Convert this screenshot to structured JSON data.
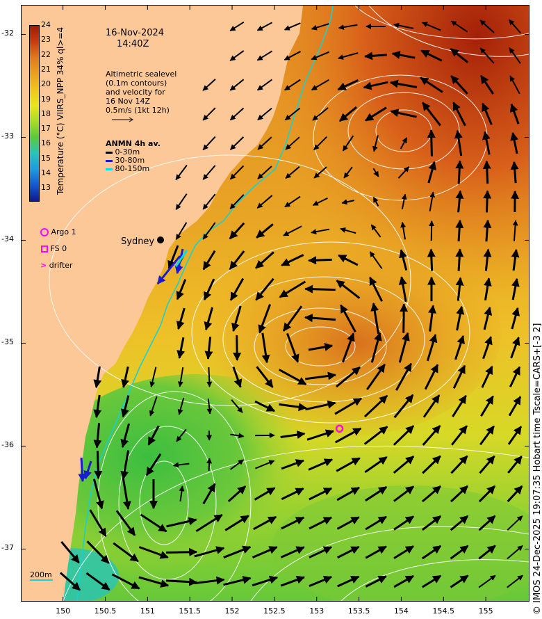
{
  "date": "16-Nov-2024",
  "time": "14:40Z",
  "altimetry_note": [
    "Altimetric sealevel",
    "(0.1m contours)",
    "and velocity for",
    "16 Nov 14Z",
    "0.5m/s (1kt 12h)"
  ],
  "colorbar": {
    "label": "Temperature (°C) VIIRS_NPP 34% ql>=4",
    "ticks": [
      "24",
      "23",
      "22",
      "21",
      "20",
      "19",
      "18",
      "17",
      "16",
      "15",
      "14",
      "13"
    ],
    "colors": [
      "#a01a08",
      "#c83c10",
      "#e07a1e",
      "#eaa020",
      "#f0c420",
      "#e8e61e",
      "#a8dc2a",
      "#5cc83a",
      "#28c4b8",
      "#1c9ce0",
      "#1458d0",
      "#101890"
    ]
  },
  "anmn": {
    "title": "ANMN 4h av.",
    "items": [
      {
        "label": "0-30m",
        "color": "#000000"
      },
      {
        "label": "30-80m",
        "color": "#1a1ad0"
      },
      {
        "label": "80-150m",
        "color": "#00e0e0"
      }
    ]
  },
  "legend": [
    {
      "label": "Argo 1",
      "symbol": "circle",
      "color": "#ff00ff"
    },
    {
      "label": "FS 0",
      "symbol": "square",
      "color": "#ff00ff"
    },
    {
      "label": "drifter",
      "symbol": "chevron",
      "color": "#ff00ff"
    }
  ],
  "city": "Sydney",
  "scale_label": "200m",
  "y_ticks": [
    "-32",
    "-33",
    "-34",
    "-35",
    "-36",
    "-37"
  ],
  "x_ticks": [
    "150",
    "150.5",
    "151",
    "151.5",
    "152",
    "152.5",
    "153",
    "153.5",
    "154",
    "154.5",
    "155"
  ],
  "credit": "© IMOS 24-Dec-2025 19:07:35 Hobart time Tscale=CARS+[-3 2]",
  "argo_float": {
    "lon": 153.27,
    "lat": -35.83
  }
}
